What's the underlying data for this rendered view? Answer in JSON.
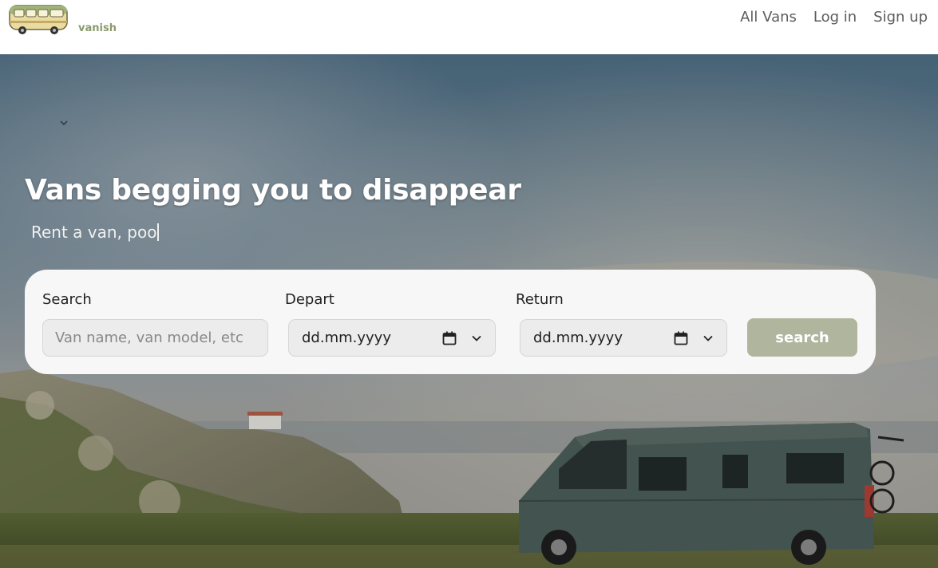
{
  "brand": {
    "name": "vanish",
    "logo_icon": "van-icon"
  },
  "nav": {
    "links": [
      "All Vans",
      "Log in",
      "Sign up"
    ]
  },
  "hero": {
    "title": "Vans begging you to disappear",
    "subtitle": "Rent a van, poo"
  },
  "search": {
    "search_label": "Search",
    "search_placeholder": "Van name, van model, etc",
    "depart_label": "Depart",
    "depart_value": "dd.mm.yyyy",
    "return_label": "Return",
    "return_value": "dd.mm.yyyy",
    "button_label": "search"
  },
  "colors": {
    "accent": "#b0b59e",
    "logo_text": "#8a9a6e",
    "nav_text": "#5b5b5b"
  }
}
